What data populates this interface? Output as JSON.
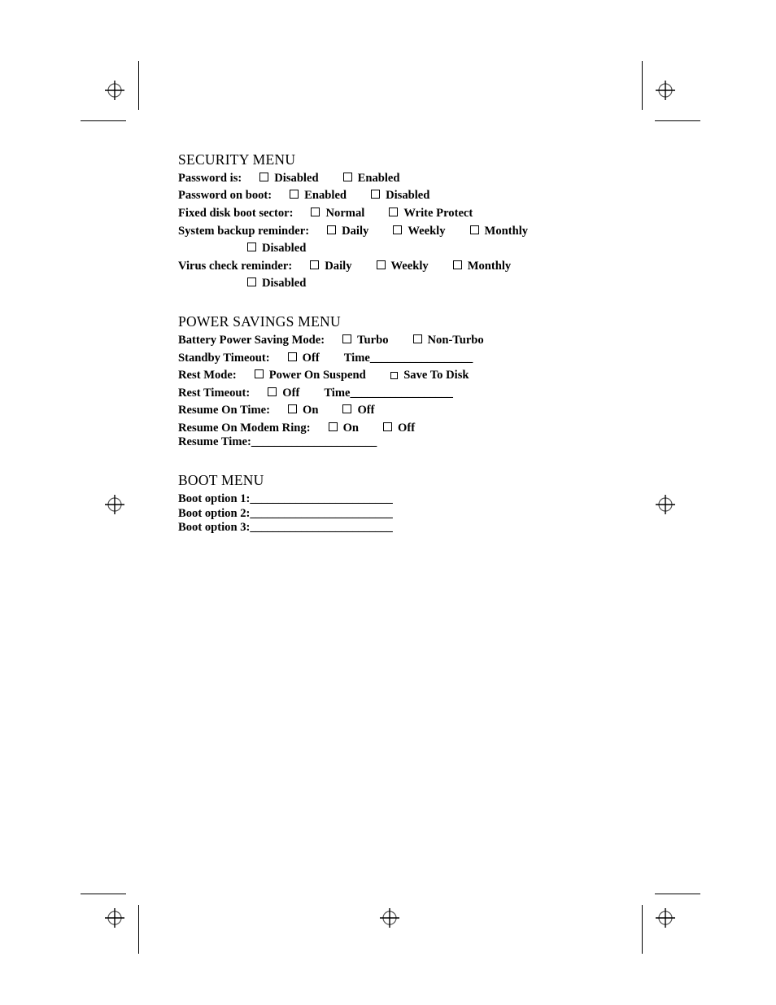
{
  "page": {
    "background_color": "#ffffff",
    "ink_color": "#000000"
  },
  "registration_marks": {
    "icon": "registration-crosshair-icon",
    "positions": [
      "top-left",
      "top-right",
      "middle-left",
      "middle-right",
      "bottom-left",
      "bottom-center",
      "bottom-right"
    ]
  },
  "sections": [
    {
      "id": "security",
      "heading": "SECURITY MENU",
      "rows": [
        {
          "label": "Password is:",
          "options": [
            "Disabled",
            "Enabled"
          ]
        },
        {
          "label": "Password on boot:",
          "options": [
            "Enabled",
            "Disabled"
          ]
        },
        {
          "label": "Fixed disk boot sector:",
          "options": [
            "Normal",
            "Write Protect"
          ]
        },
        {
          "label": "System backup reminder:",
          "options": [
            "Daily",
            "Weekly",
            "Monthly"
          ],
          "continuation_options": [
            "Disabled"
          ]
        },
        {
          "label": "Virus check reminder:",
          "options": [
            "Daily",
            "Weekly",
            "Monthly"
          ],
          "continuation_options": [
            "Disabled"
          ]
        }
      ]
    },
    {
      "id": "power_savings",
      "heading": "POWER SAVINGS MENU",
      "rows": [
        {
          "label": "Battery Power Saving Mode:",
          "options": [
            "Turbo",
            "Non-Turbo"
          ]
        },
        {
          "label": "Standby Timeout:",
          "options": [
            "Off"
          ],
          "field_label": "Time",
          "field_blank": "__________________"
        },
        {
          "label": "Rest Mode:",
          "options": [
            "Power On Suspend",
            "Save To Disk"
          ]
        },
        {
          "label": "Rest Timeout:",
          "options": [
            "Off"
          ],
          "field_label": "Time",
          "field_blank": "__________________"
        },
        {
          "label": "Resume On Time:",
          "options": [
            "On",
            "Off"
          ]
        },
        {
          "label": "Resume On Modem Ring:",
          "options": [
            "On",
            "Off"
          ]
        },
        {
          "label": "Resume Time:",
          "field_blank": "______________________"
        }
      ]
    },
    {
      "id": "boot",
      "heading": "BOOT MENU",
      "rows": [
        {
          "label": "Boot option 1:",
          "field_blank": "_________________________"
        },
        {
          "label": "Boot option 2:",
          "field_blank": "_________________________"
        },
        {
          "label": "Boot option 3:",
          "field_blank": "_________________________"
        }
      ]
    }
  ]
}
